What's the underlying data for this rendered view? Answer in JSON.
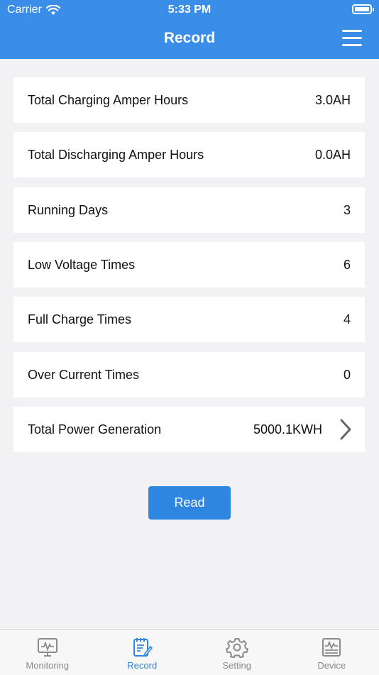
{
  "status": {
    "carrier": "Carrier",
    "time": "5:33 PM"
  },
  "header": {
    "title": "Record",
    "menu_icon": "hamburger-menu-icon"
  },
  "records": [
    {
      "label": "Total Charging Amper Hours",
      "value": "3.0AH"
    },
    {
      "label": "Total Discharging Amper Hours",
      "value": "0.0AH"
    },
    {
      "label": "Running Days",
      "value": "3"
    },
    {
      "label": "Low Voltage Times",
      "value": "6"
    },
    {
      "label": "Full Charge Times",
      "value": "4"
    },
    {
      "label": "Over Current Times",
      "value": "0"
    },
    {
      "label": "Total Power Generation",
      "value": "5000.1KWH"
    }
  ],
  "read_button": "Read",
  "tabs": [
    {
      "label": "Monitoring",
      "icon": "monitor-chart-icon",
      "active": false
    },
    {
      "label": "Record",
      "icon": "record-notepad-icon",
      "active": true
    },
    {
      "label": "Setting",
      "icon": "gear-icon",
      "active": false
    },
    {
      "label": "Device",
      "icon": "device-chart-icon",
      "active": false
    }
  ],
  "colors": {
    "accent": "#3b8ee8",
    "button": "#2f86e0",
    "background": "#f2f2f4"
  }
}
